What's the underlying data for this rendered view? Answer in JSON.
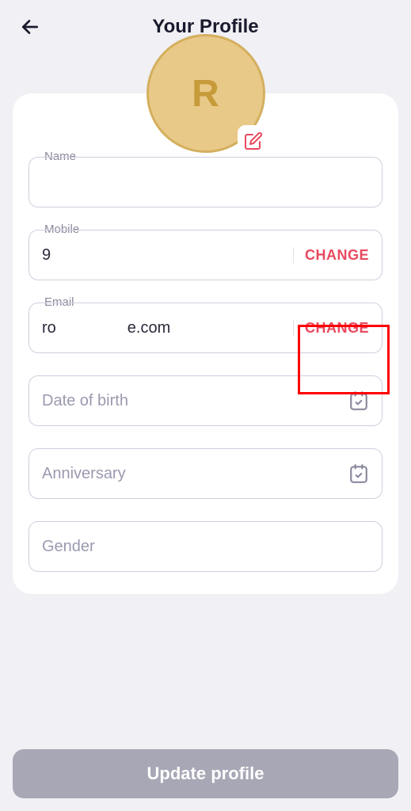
{
  "header": {
    "title": "Your Profile"
  },
  "avatar": {
    "initial": "R"
  },
  "fields": {
    "name": {
      "label": "Name",
      "value": ""
    },
    "mobile": {
      "label": "Mobile",
      "value": "9",
      "change": "CHANGE"
    },
    "email": {
      "label": "Email",
      "part1": "ro",
      "part2": "e.com",
      "change": "CHANGE"
    },
    "dob": {
      "placeholder": "Date of birth"
    },
    "anniversary": {
      "placeholder": "Anniversary"
    },
    "gender": {
      "placeholder": "Gender"
    }
  },
  "actions": {
    "update": "Update profile"
  }
}
